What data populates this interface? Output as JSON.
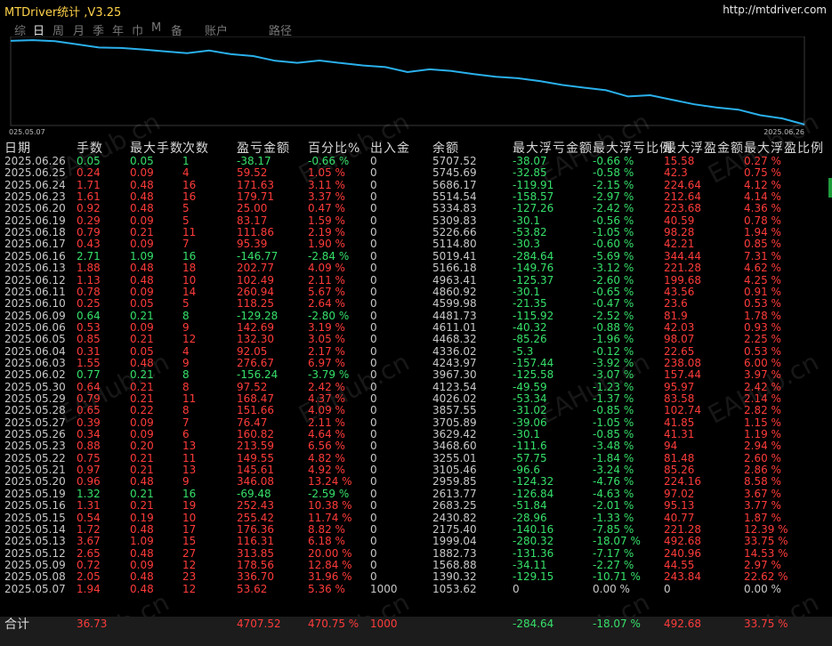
{
  "app": {
    "title": "MTDriver统计 ,V3.25",
    "url": "http://mtdriver.com"
  },
  "tabs": [
    {
      "label": "综",
      "active": false
    },
    {
      "label": "日",
      "active": true
    },
    {
      "label": "周",
      "active": false
    },
    {
      "label": "月",
      "active": false
    },
    {
      "label": "季",
      "active": false
    },
    {
      "label": "年",
      "active": false
    },
    {
      "label": "巾",
      "active": false
    },
    {
      "label": "M",
      "active": false
    },
    {
      "label": "备",
      "active": false
    },
    {
      "label": "账户",
      "active": false
    },
    {
      "label": "路径",
      "active": false
    }
  ],
  "chart_data": {
    "type": "line",
    "x_start_label": "025.05.07",
    "x_end_label": "2025.06.26",
    "line_color": "#2ab0ec",
    "values": [
      1053.62,
      1390.32,
      1568.88,
      1882.73,
      1999.04,
      2175.4,
      2430.82,
      2683.25,
      2613.77,
      2959.85,
      3105.46,
      3255.01,
      3468.6,
      3629.42,
      3705.89,
      3857.55,
      4026.02,
      4123.54,
      3967.3,
      4243.97,
      4336.02,
      4468.32,
      4611.01,
      4481.73,
      4599.98,
      4860.92,
      4963.41,
      5166.18,
      5019.41,
      5114.8,
      5226.66,
      5309.83,
      5334.83,
      5514.54,
      5686.17,
      5745.69,
      5707.52
    ],
    "ylim": [
      1000,
      5800
    ]
  },
  "watermark": "EAHub.cn",
  "table": {
    "headers": [
      "日期",
      "手数",
      "最大手数",
      "次数",
      "盈亏金额",
      "百分比%",
      "出入金",
      "余额",
      "最大浮亏金额",
      "最大浮亏比例",
      "最大浮盈金额",
      "最大浮盈比例"
    ],
    "rows": [
      [
        "2025.06.26",
        "0.05",
        "0.05",
        "1",
        "-38.17",
        "-0.66 %",
        "0",
        "5707.52",
        "-38.07",
        "-0.66 %",
        "15.58",
        "0.27 %"
      ],
      [
        "2025.06.25",
        "0.24",
        "0.09",
        "4",
        "59.52",
        "1.05 %",
        "0",
        "5745.69",
        "-32.85",
        "-0.58 %",
        "42.3",
        "0.75 %"
      ],
      [
        "2025.06.24",
        "1.71",
        "0.48",
        "16",
        "171.63",
        "3.11 %",
        "0",
        "5686.17",
        "-119.91",
        "-2.15 %",
        "224.64",
        "4.12 %"
      ],
      [
        "2025.06.23",
        "1.61",
        "0.48",
        "16",
        "179.71",
        "3.37 %",
        "0",
        "5514.54",
        "-158.57",
        "-2.97 %",
        "212.64",
        "4.14 %"
      ],
      [
        "2025.06.20",
        "0.92",
        "0.48",
        "5",
        "25.00",
        "0.47 %",
        "0",
        "5334.83",
        "-127.26",
        "-2.42 %",
        "223.68",
        "4.36 %"
      ],
      [
        "2025.06.19",
        "0.29",
        "0.09",
        "5",
        "83.17",
        "1.59 %",
        "0",
        "5309.83",
        "-30.1",
        "-0.56 %",
        "40.59",
        "0.78 %"
      ],
      [
        "2025.06.18",
        "0.79",
        "0.21",
        "11",
        "111.86",
        "2.19 %",
        "0",
        "5226.66",
        "-53.82",
        "-1.05 %",
        "98.28",
        "1.94 %"
      ],
      [
        "2025.06.17",
        "0.43",
        "0.09",
        "7",
        "95.39",
        "1.90 %",
        "0",
        "5114.80",
        "-30.3",
        "-0.60 %",
        "42.21",
        "0.85 %"
      ],
      [
        "2025.06.16",
        "2.71",
        "1.09",
        "16",
        "-146.77",
        "-2.84 %",
        "0",
        "5019.41",
        "-284.64",
        "-5.69 %",
        "344.44",
        "7.31 %"
      ],
      [
        "2025.06.13",
        "1.88",
        "0.48",
        "18",
        "202.77",
        "4.09 %",
        "0",
        "5166.18",
        "-149.76",
        "-3.12 %",
        "221.28",
        "4.62 %"
      ],
      [
        "2025.06.12",
        "1.13",
        "0.48",
        "10",
        "102.49",
        "2.11 %",
        "0",
        "4963.41",
        "-125.37",
        "-2.60 %",
        "199.68",
        "4.25 %"
      ],
      [
        "2025.06.11",
        "0.78",
        "0.09",
        "14",
        "260.94",
        "5.67 %",
        "0",
        "4860.92",
        "-30.1",
        "-0.65 %",
        "43.56",
        "0.91 %"
      ],
      [
        "2025.06.10",
        "0.25",
        "0.05",
        "5",
        "118.25",
        "2.64 %",
        "0",
        "4599.98",
        "-21.35",
        "-0.47 %",
        "23.6",
        "0.53 %"
      ],
      [
        "2025.06.09",
        "0.64",
        "0.21",
        "8",
        "-129.28",
        "-2.80 %",
        "0",
        "4481.73",
        "-115.92",
        "-2.52 %",
        "81.9",
        "1.78 %"
      ],
      [
        "2025.06.06",
        "0.53",
        "0.09",
        "9",
        "142.69",
        "3.19 %",
        "0",
        "4611.01",
        "-40.32",
        "-0.88 %",
        "42.03",
        "0.93 %"
      ],
      [
        "2025.06.05",
        "0.85",
        "0.21",
        "12",
        "132.30",
        "3.05 %",
        "0",
        "4468.32",
        "-85.26",
        "-1.96 %",
        "98.07",
        "2.25 %"
      ],
      [
        "2025.06.04",
        "0.31",
        "0.05",
        "4",
        "92.05",
        "2.17 %",
        "0",
        "4336.02",
        "-5.3",
        "-0.12 %",
        "22.65",
        "0.53 %"
      ],
      [
        "2025.06.03",
        "1.55",
        "0.48",
        "9",
        "276.67",
        "6.97 %",
        "0",
        "4243.97",
        "-157.44",
        "-3.92 %",
        "238.08",
        "6.00 %"
      ],
      [
        "2025.06.02",
        "0.77",
        "0.21",
        "8",
        "-156.24",
        "-3.79 %",
        "0",
        "3967.30",
        "-125.58",
        "-3.07 %",
        "157.44",
        "3.97 %"
      ],
      [
        "2025.05.30",
        "0.64",
        "0.21",
        "8",
        "97.52",
        "2.42 %",
        "0",
        "4123.54",
        "-49.59",
        "-1.23 %",
        "95.97",
        "2.42 %"
      ],
      [
        "2025.05.29",
        "0.79",
        "0.21",
        "11",
        "168.47",
        "4.37 %",
        "0",
        "4026.02",
        "-53.34",
        "-1.37 %",
        "83.58",
        "2.14 %"
      ],
      [
        "2025.05.28",
        "0.65",
        "0.22",
        "8",
        "151.66",
        "4.09 %",
        "0",
        "3857.55",
        "-31.02",
        "-0.85 %",
        "102.74",
        "2.82 %"
      ],
      [
        "2025.05.27",
        "0.39",
        "0.09",
        "7",
        "76.47",
        "2.11 %",
        "0",
        "3705.89",
        "-39.06",
        "-1.05 %",
        "41.85",
        "1.15 %"
      ],
      [
        "2025.05.26",
        "0.34",
        "0.09",
        "6",
        "160.82",
        "4.64 %",
        "0",
        "3629.42",
        "-30.1",
        "-0.85 %",
        "41.31",
        "1.19 %"
      ],
      [
        "2025.05.23",
        "0.88",
        "0.20",
        "13",
        "213.59",
        "6.56 %",
        "0",
        "3468.60",
        "-111.6",
        "-3.48 %",
        "94",
        "2.94 %"
      ],
      [
        "2025.05.22",
        "0.75",
        "0.21",
        "11",
        "149.55",
        "4.82 %",
        "0",
        "3255.01",
        "-57.75",
        "-1.84 %",
        "81.48",
        "2.60 %"
      ],
      [
        "2025.05.21",
        "0.97",
        "0.21",
        "13",
        "145.61",
        "4.92 %",
        "0",
        "3105.46",
        "-96.6",
        "-3.24 %",
        "85.26",
        "2.86 %"
      ],
      [
        "2025.05.20",
        "0.96",
        "0.48",
        "9",
        "346.08",
        "13.24 %",
        "0",
        "2959.85",
        "-124.32",
        "-4.76 %",
        "224.16",
        "8.58 %"
      ],
      [
        "2025.05.19",
        "1.32",
        "0.21",
        "16",
        "-69.48",
        "-2.59 %",
        "0",
        "2613.77",
        "-126.84",
        "-4.63 %",
        "97.02",
        "3.67 %"
      ],
      [
        "2025.05.16",
        "1.31",
        "0.21",
        "19",
        "252.43",
        "10.38 %",
        "0",
        "2683.25",
        "-51.84",
        "-2.01 %",
        "95.13",
        "3.77 %"
      ],
      [
        "2025.05.15",
        "0.54",
        "0.19",
        "10",
        "255.42",
        "11.74 %",
        "0",
        "2430.82",
        "-28.96",
        "-1.33 %",
        "40.77",
        "1.87 %"
      ],
      [
        "2025.05.14",
        "1.72",
        "0.48",
        "17",
        "176.36",
        "8.82 %",
        "0",
        "2175.40",
        "-140.16",
        "-7.85 %",
        "221.28",
        "12.39 %"
      ],
      [
        "2025.05.13",
        "3.67",
        "1.09",
        "15",
        "116.31",
        "6.18 %",
        "0",
        "1999.04",
        "-280.32",
        "-18.07 %",
        "492.68",
        "33.75 %"
      ],
      [
        "2025.05.12",
        "2.65",
        "0.48",
        "27",
        "313.85",
        "20.00 %",
        "0",
        "1882.73",
        "-131.36",
        "-7.17 %",
        "240.96",
        "14.53 %"
      ],
      [
        "2025.05.09",
        "0.72",
        "0.09",
        "12",
        "178.56",
        "12.84 %",
        "0",
        "1568.88",
        "-34.11",
        "-2.27 %",
        "44.55",
        "2.97 %"
      ],
      [
        "2025.05.08",
        "2.05",
        "0.48",
        "23",
        "336.70",
        "31.96 %",
        "0",
        "1390.32",
        "-129.15",
        "-10.71 %",
        "243.84",
        "22.62 %"
      ],
      [
        "2025.05.07",
        "1.94",
        "0.48",
        "12",
        "53.62",
        "5.36 %",
        "1000",
        "1053.62",
        "0",
        "0.00 %",
        "0",
        "0.00 %"
      ]
    ],
    "summary": {
      "label": "合计",
      "values": [
        "36.73",
        "",
        "",
        "4707.52",
        "470.75 %",
        "1000",
        "",
        "-284.64",
        "-18.07 %",
        "492.68",
        "33.75 %"
      ]
    }
  }
}
